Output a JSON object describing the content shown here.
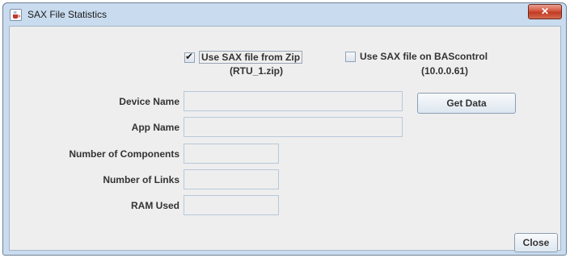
{
  "window": {
    "title": "SAX File Statistics",
    "close_glyph": "✕"
  },
  "options": {
    "zip": {
      "label": "Use SAX file from Zip",
      "sub": "(RTU_1.zip)",
      "checked": true
    },
    "bascontrol": {
      "label": "Use SAX file on BAScontrol",
      "sub": "(10.0.0.61)",
      "checked": false
    }
  },
  "fields": {
    "device_name": {
      "label": "Device Name",
      "value": ""
    },
    "app_name": {
      "label": "App Name",
      "value": ""
    },
    "num_components": {
      "label": "Number of Components",
      "value": ""
    },
    "num_links": {
      "label": "Number of Links",
      "value": ""
    },
    "ram_used": {
      "label": "RAM Used",
      "value": ""
    }
  },
  "buttons": {
    "get_data": "Get Data",
    "close": "Close"
  },
  "icons": {
    "app": "java-cup-icon",
    "close": "close-icon",
    "checkbox": "checkmark-icon"
  }
}
